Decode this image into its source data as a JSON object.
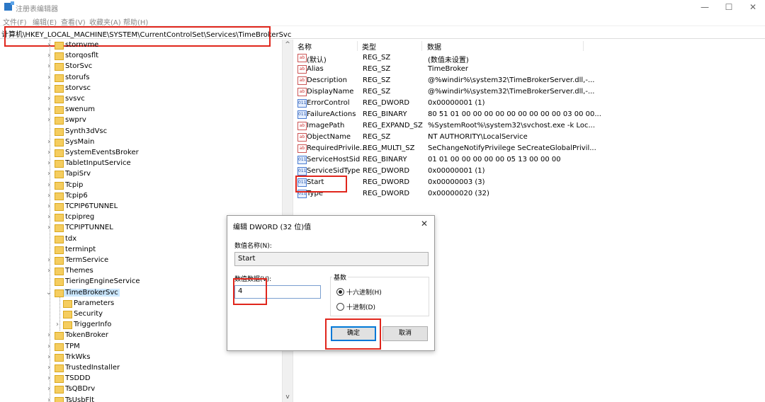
{
  "window": {
    "title": "注册表编辑器",
    "minimize": "—",
    "maximize": "☐",
    "close": "✕"
  },
  "menu": [
    "文件(F)",
    "编辑(E)",
    "查看(V)",
    "收藏夹(A)",
    "帮助(H)"
  ],
  "address": "计算机\\HKEY_LOCAL_MACHINE\\SYSTEM\\CurrentControlSet\\Services\\TimeBrokerSvc",
  "tree": [
    {
      "label": "stornvme",
      "expander": "›"
    },
    {
      "label": "storqosflt",
      "expander": "›"
    },
    {
      "label": "StorSvc",
      "expander": "›"
    },
    {
      "label": "storufs",
      "expander": "›"
    },
    {
      "label": "storvsc",
      "expander": "›"
    },
    {
      "label": "svsvc",
      "expander": "›"
    },
    {
      "label": "swenum",
      "expander": "›"
    },
    {
      "label": "swprv",
      "expander": "›"
    },
    {
      "label": "Synth3dVsc",
      "expander": ""
    },
    {
      "label": "SysMain",
      "expander": "›"
    },
    {
      "label": "SystemEventsBroker",
      "expander": "›"
    },
    {
      "label": "TabletInputService",
      "expander": "›"
    },
    {
      "label": "TapiSrv",
      "expander": "›"
    },
    {
      "label": "Tcpip",
      "expander": "›"
    },
    {
      "label": "Tcpip6",
      "expander": "›"
    },
    {
      "label": "TCPIP6TUNNEL",
      "expander": "›"
    },
    {
      "label": "tcpipreg",
      "expander": "›"
    },
    {
      "label": "TCPIPTUNNEL",
      "expander": "›"
    },
    {
      "label": "tdx",
      "expander": ""
    },
    {
      "label": "terminpt",
      "expander": ""
    },
    {
      "label": "TermService",
      "expander": "›"
    },
    {
      "label": "Themes",
      "expander": "›"
    },
    {
      "label": "TieringEngineService",
      "expander": ""
    },
    {
      "label": "TimeBrokerSvc",
      "expander": "⌄"
    },
    {
      "label": "Parameters",
      "expander": ""
    },
    {
      "label": "Security",
      "expander": ""
    },
    {
      "label": "TriggerInfo",
      "expander": "›"
    },
    {
      "label": "TokenBroker",
      "expander": "›"
    },
    {
      "label": "TPM",
      "expander": "›"
    },
    {
      "label": "TrkWks",
      "expander": "›"
    },
    {
      "label": "TrustedInstaller",
      "expander": "›"
    },
    {
      "label": "TSDDD",
      "expander": "›"
    },
    {
      "label": "TsQBDrv",
      "expander": "›"
    },
    {
      "label": "TsUsbFlt",
      "expander": "›"
    }
  ],
  "scroll": {
    "up": "^",
    "down": "v"
  },
  "columns": {
    "name": "名称",
    "type": "类型",
    "data": "数据"
  },
  "values": [
    {
      "icon": "ab",
      "name": "(默认)",
      "type": "REG_SZ",
      "data": "(数值未设置)"
    },
    {
      "icon": "ab",
      "name": "Alias",
      "type": "REG_SZ",
      "data": "TimeBroker"
    },
    {
      "icon": "ab",
      "name": "Description",
      "type": "REG_SZ",
      "data": "@%windir%\\system32\\TimeBrokerServer.dll,-..."
    },
    {
      "icon": "ab",
      "name": "DisplayName",
      "type": "REG_SZ",
      "data": "@%windir%\\system32\\TimeBrokerServer.dll,-..."
    },
    {
      "icon": "011",
      "name": "ErrorControl",
      "type": "REG_DWORD",
      "data": "0x00000001 (1)"
    },
    {
      "icon": "011",
      "name": "FailureActions",
      "type": "REG_BINARY",
      "data": "80 51 01 00 00 00 00 00 00 00 00 00 03 00 00..."
    },
    {
      "icon": "ab",
      "name": "ImagePath",
      "type": "REG_EXPAND_SZ",
      "data": "%SystemRoot%\\system32\\svchost.exe -k Loc..."
    },
    {
      "icon": "ab",
      "name": "ObjectName",
      "type": "REG_SZ",
      "data": "NT AUTHORITY\\LocalService"
    },
    {
      "icon": "ab",
      "name": "RequiredPrivile...",
      "type": "REG_MULTI_SZ",
      "data": "SeChangeNotifyPrivilege SeCreateGlobalPrivil..."
    },
    {
      "icon": "011",
      "name": "ServiceHostSid",
      "type": "REG_BINARY",
      "data": "01 01 00 00 00 00 00 05 13 00 00 00"
    },
    {
      "icon": "011",
      "name": "ServiceSidType",
      "type": "REG_DWORD",
      "data": "0x00000001 (1)"
    },
    {
      "icon": "011",
      "name": "Start",
      "type": "REG_DWORD",
      "data": "0x00000003 (3)"
    },
    {
      "icon": "011",
      "name": "Type",
      "type": "REG_DWORD",
      "data": "0x00000020 (32)"
    }
  ],
  "dialog": {
    "title": "编辑 DWORD (32 位)值",
    "close": "✕",
    "name_label": "数值名称(N):",
    "name_value": "Start",
    "data_label": "数值数据(V):",
    "data_value": "4",
    "base_label": "基数",
    "hex_label": "十六进制(H)",
    "dec_label": "十进制(D)",
    "ok": "确定",
    "cancel": "取消"
  },
  "highlight_color": "#e0261c"
}
